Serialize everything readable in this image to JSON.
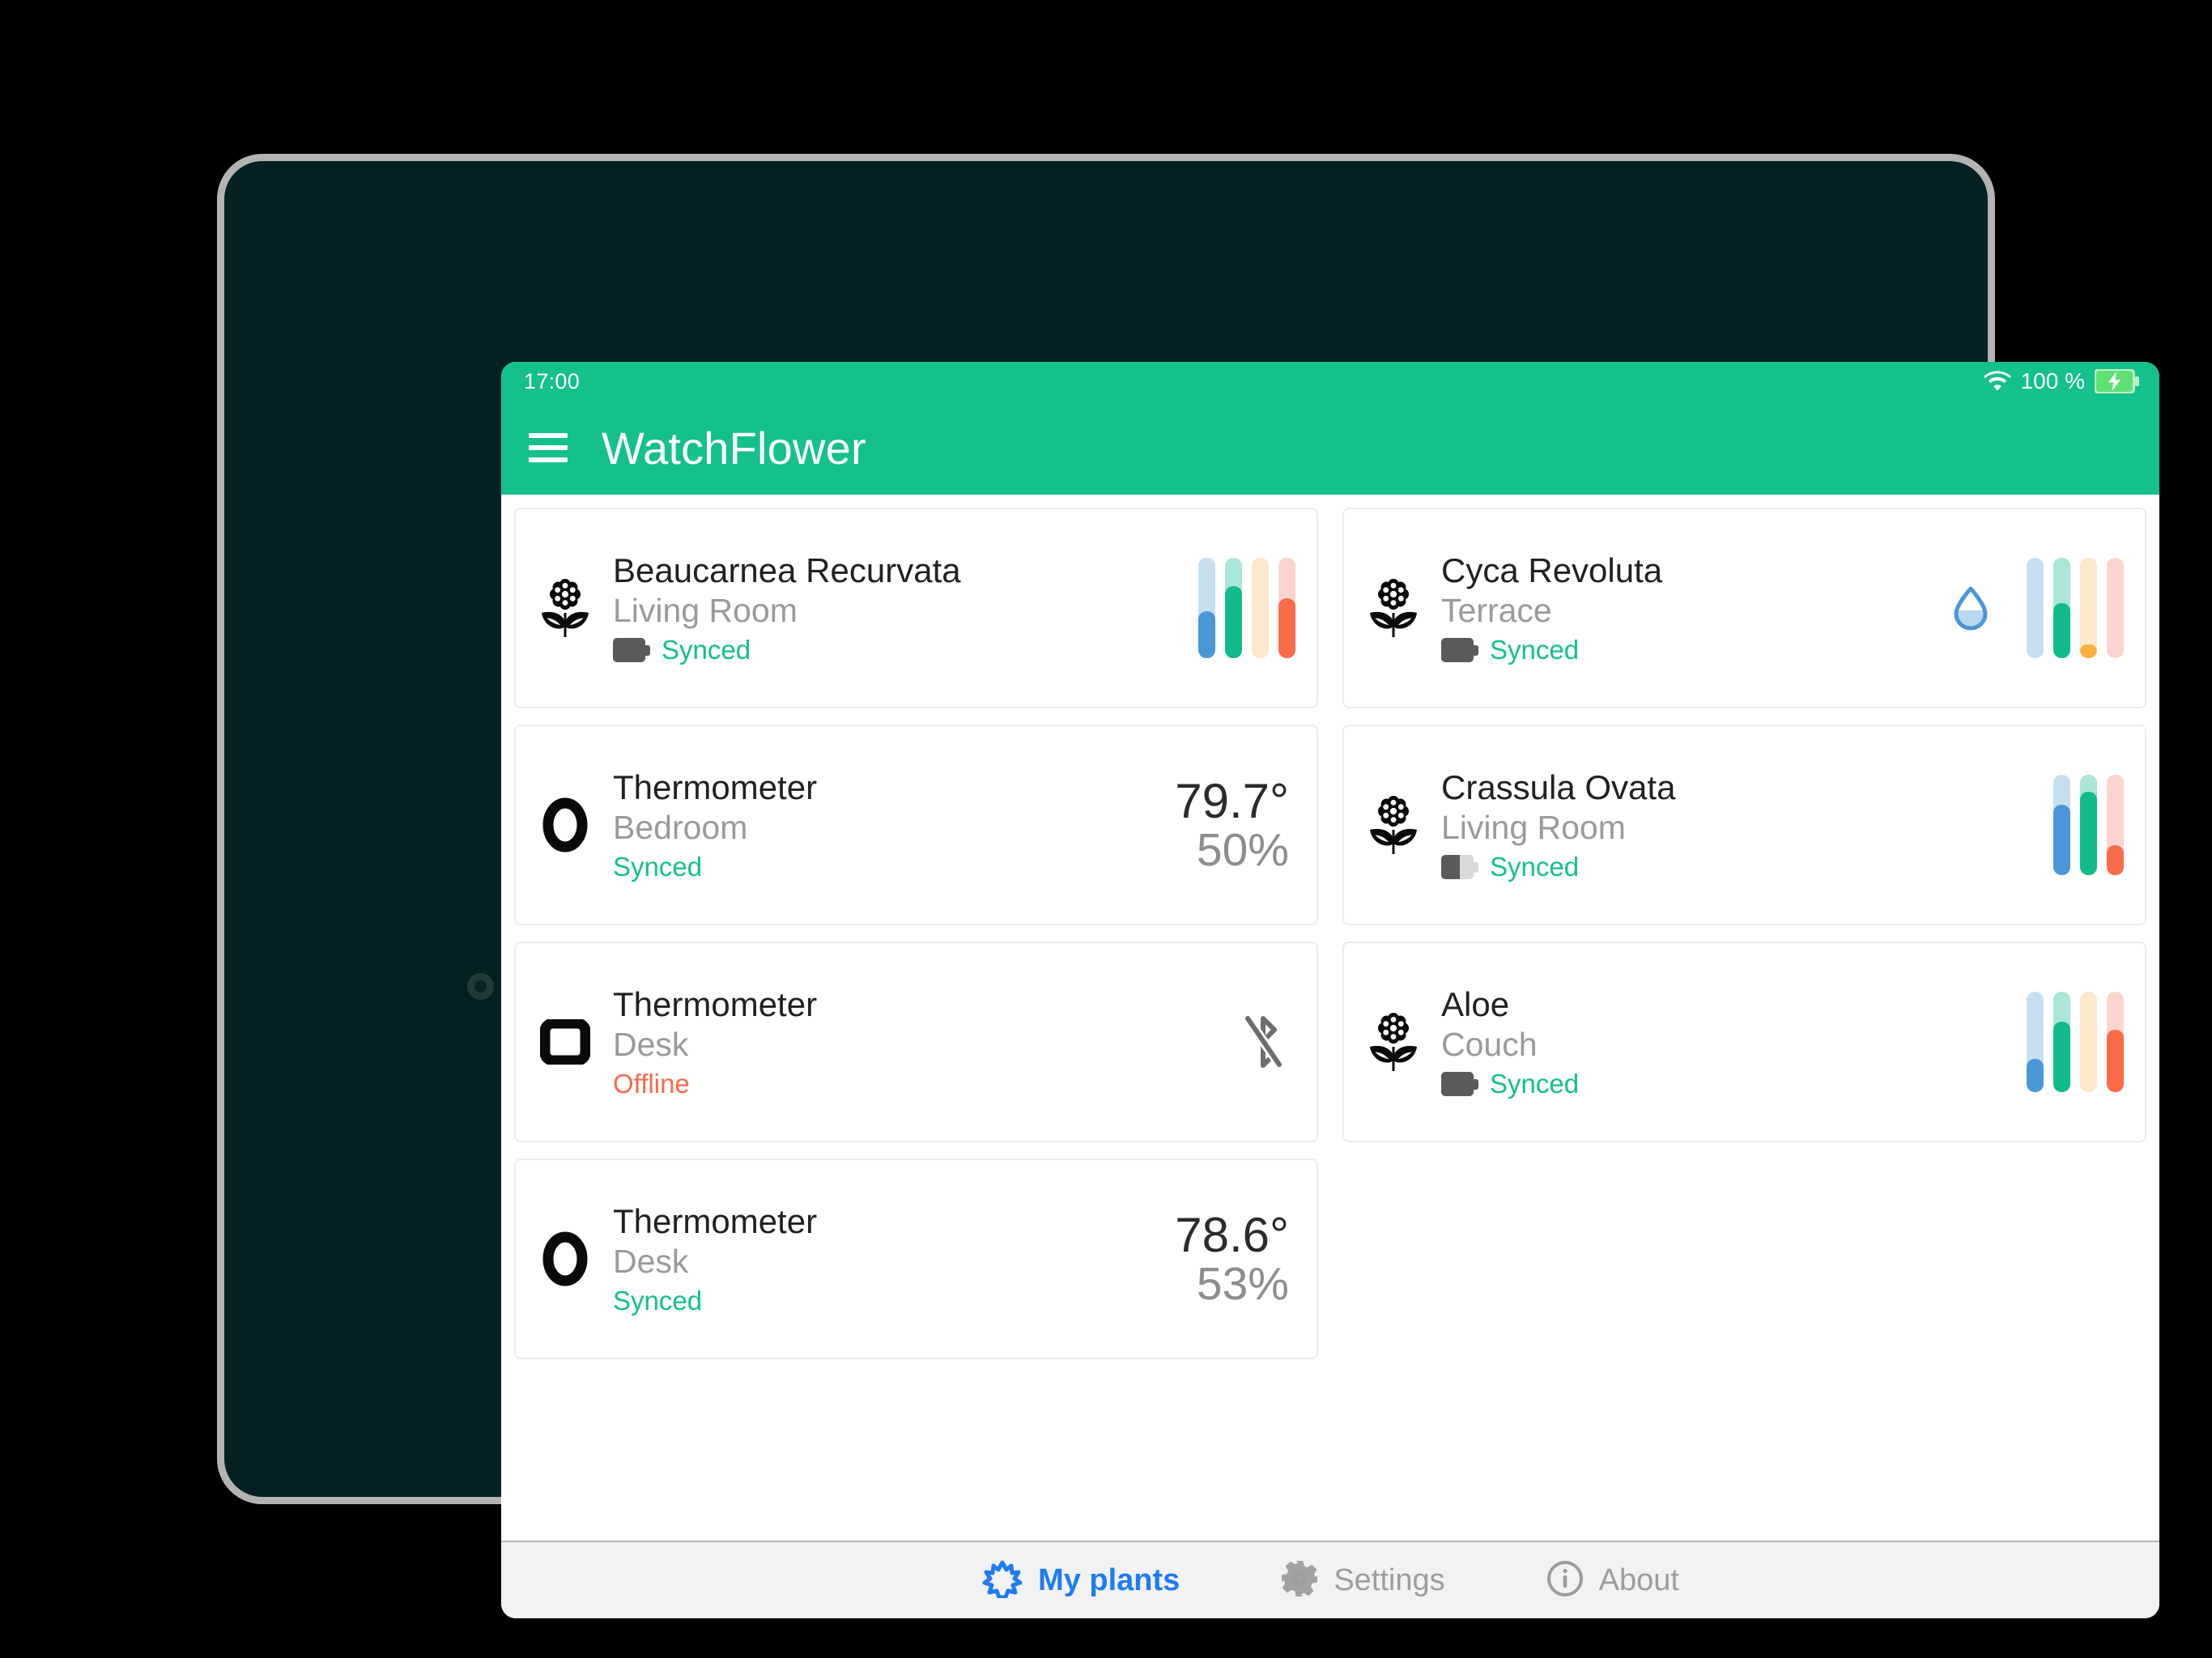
{
  "status_bar": {
    "clock": "17:00",
    "battery_percent": "100 %",
    "wifi_icon": "wifi-icon",
    "battery_icon": "battery-charging-icon"
  },
  "app_bar": {
    "menu_icon": "hamburger-menu-icon",
    "title": "WatchFlower"
  },
  "colors": {
    "accent_green": "#14c08c",
    "synced_green": "#14c08c",
    "offline_red": "#f96a4c",
    "nav_active_blue": "#1f7bf4",
    "bar_blue": "#4a97d8",
    "bar_blue_track": "#c6e0f2",
    "bar_green": "#11bc8a",
    "bar_green_track": "#a9e6d7",
    "bar_orange": "#fcb040",
    "bar_orange_track": "#fce8ca",
    "bar_red": "#fa6b4a",
    "bar_red_track": "#fbd5cd"
  },
  "devices": [
    {
      "icon": "flower-icon",
      "title": "Beaucarnea Recurvata",
      "location": "Living Room",
      "status": "Synced",
      "status_kind": "synced",
      "battery": {
        "show": true,
        "level": 100
      },
      "readout": null,
      "drop": false,
      "bluetooth_off": false,
      "bars": [
        {
          "name": "moisture",
          "fill_pct": 47,
          "color": "#4a97d8",
          "track": "#c6e0f2"
        },
        {
          "name": "soil-conductivity",
          "fill_pct": 72,
          "color": "#11bc8a",
          "track": "#a9e6d7"
        },
        {
          "name": "luminosity",
          "fill_pct": 0,
          "color": "#fcb040",
          "track": "#fce8ca"
        },
        {
          "name": "temperature",
          "fill_pct": 60,
          "color": "#fa6b4a",
          "track": "#fbd5cd"
        }
      ]
    },
    {
      "icon": "flower-icon",
      "title": "Cyca Revoluta",
      "location": "Terrace",
      "status": "Synced",
      "status_kind": "synced",
      "battery": {
        "show": true,
        "level": 100
      },
      "readout": null,
      "drop": true,
      "bluetooth_off": false,
      "bars": [
        {
          "name": "moisture",
          "fill_pct": 0,
          "color": "#4a97d8",
          "track": "#c6e0f2"
        },
        {
          "name": "soil-conductivity",
          "fill_pct": 55,
          "color": "#11bc8a",
          "track": "#a9e6d7"
        },
        {
          "name": "luminosity",
          "fill_pct": 14,
          "color": "#fcb040",
          "track": "#fce8ca"
        },
        {
          "name": "temperature",
          "fill_pct": 0,
          "color": "#fa6b4a",
          "track": "#fbd5cd"
        }
      ]
    },
    {
      "icon": "thermometer-ring-icon",
      "title": "Thermometer",
      "location": "Bedroom",
      "status": "Synced",
      "status_kind": "synced",
      "battery": {
        "show": false,
        "level": 0
      },
      "readout": {
        "temperature": "79.7°",
        "humidity": "50%"
      },
      "drop": false,
      "bluetooth_off": false,
      "bars": []
    },
    {
      "icon": "flower-icon",
      "title": "Crassula Ovata",
      "location": "Living Room",
      "status": "Synced",
      "status_kind": "synced",
      "battery": {
        "show": true,
        "level": 58
      },
      "readout": null,
      "drop": false,
      "bluetooth_off": false,
      "bars": [
        {
          "name": "moisture",
          "fill_pct": 70,
          "color": "#4a97d8",
          "track": "#c6e0f2"
        },
        {
          "name": "soil-conductivity",
          "fill_pct": 83,
          "color": "#11bc8a",
          "track": "#a9e6d7"
        },
        {
          "name": "temperature",
          "fill_pct": 30,
          "color": "#fa6b4a",
          "track": "#fbd5cd"
        }
      ]
    },
    {
      "icon": "thermometer-square-icon",
      "title": "Thermometer",
      "location": "Desk",
      "status": "Offline",
      "status_kind": "offline",
      "battery": {
        "show": false,
        "level": 0
      },
      "readout": null,
      "drop": false,
      "bluetooth_off": true,
      "bars": []
    },
    {
      "icon": "flower-icon",
      "title": "Aloe",
      "location": "Couch",
      "status": "Synced",
      "status_kind": "synced",
      "battery": {
        "show": true,
        "level": 100
      },
      "readout": null,
      "drop": false,
      "bluetooth_off": false,
      "bars": [
        {
          "name": "moisture",
          "fill_pct": 33,
          "color": "#4a97d8",
          "track": "#c6e0f2"
        },
        {
          "name": "soil-conductivity",
          "fill_pct": 70,
          "color": "#11bc8a",
          "track": "#a9e6d7"
        },
        {
          "name": "luminosity",
          "fill_pct": 0,
          "color": "#fcb040",
          "track": "#fce8ca"
        },
        {
          "name": "temperature",
          "fill_pct": 62,
          "color": "#fa6b4a",
          "track": "#fbd5cd"
        }
      ]
    },
    {
      "icon": "thermometer-ring-icon",
      "title": "Thermometer",
      "location": "Desk",
      "status": "Synced",
      "status_kind": "synced",
      "battery": {
        "show": false,
        "level": 0
      },
      "readout": {
        "temperature": "78.6°",
        "humidity": "53%"
      },
      "drop": false,
      "bluetooth_off": false,
      "bars": []
    }
  ],
  "bottom_nav": [
    {
      "label": "My plants",
      "icon": "plant-icon",
      "active": true
    },
    {
      "label": "Settings",
      "icon": "gear-icon",
      "active": false
    },
    {
      "label": "About",
      "icon": "info-icon",
      "active": false
    }
  ]
}
